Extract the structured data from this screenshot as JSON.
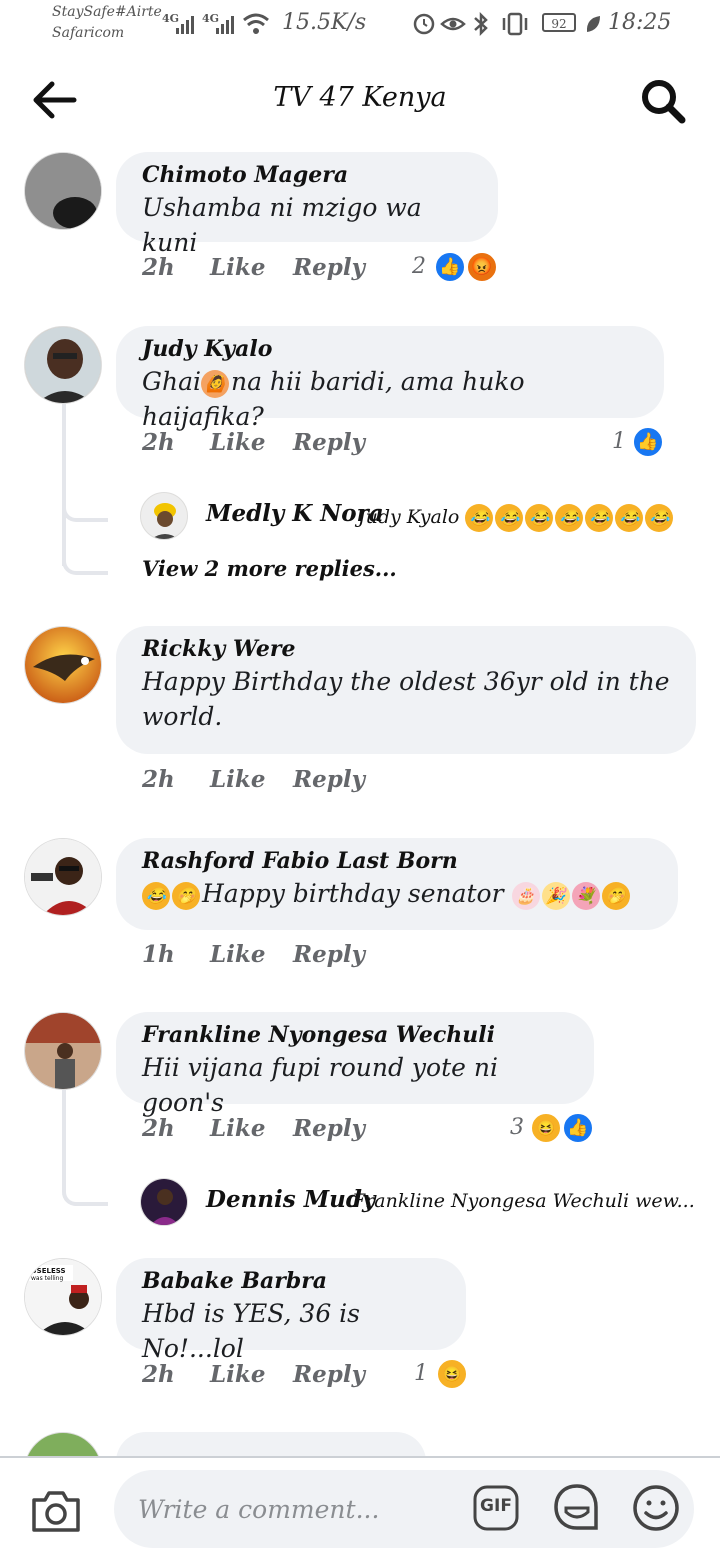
{
  "status_bar": {
    "carrier_1": "StaySafe#Airte",
    "carrier_2": "Safaricom",
    "network_1": "4G",
    "network_2": "4G",
    "speed": "15.5K/s",
    "battery": "92",
    "time": "18:25"
  },
  "header": {
    "title": "TV 47 Kenya"
  },
  "comments": [
    {
      "author": "Chimoto Magera",
      "text": "Ushamba ni mzigo wa kuni",
      "time": "2h",
      "like": "Like",
      "reply": "Reply",
      "reaction_count": "2",
      "reactions": [
        "like",
        "angry"
      ]
    },
    {
      "author": "Judy Kyalo",
      "text_a": "Ghai",
      "text_b": "na hii baridi, ama huko haijafika?",
      "time": "2h",
      "like": "Like",
      "reply": "Reply",
      "reaction_count": "1",
      "reactions": [
        "like"
      ],
      "reply_preview": {
        "author": "Medly K Nora",
        "text": "Judy Kyalo"
      },
      "view_more": "View 2 more replies..."
    },
    {
      "author": "Rickky Were",
      "text_line1": "Happy Birthday the oldest 36yr old in the",
      "text_line2": "world.",
      "time": "2h",
      "like": "Like",
      "reply": "Reply"
    },
    {
      "author": "Rashford Fabio Last Born",
      "text": "Happy birthday senator",
      "time": "1h",
      "like": "Like",
      "reply": "Reply"
    },
    {
      "author": "Frankline Nyongesa Wechuli",
      "text": "Hii vijana fupi round yote ni goon's",
      "time": "2h",
      "like": "Like",
      "reply": "Reply",
      "reaction_count": "3",
      "reactions": [
        "haha",
        "like"
      ],
      "reply_preview": {
        "author": "Dennis Mudy",
        "text": "Frankline Nyongesa Wechuli wew..."
      }
    },
    {
      "author": "Babake Barbra",
      "text": "Hbd is YES, 36 is No!...lol",
      "time": "2h",
      "like": "Like",
      "reply": "Reply",
      "reaction_count": "1",
      "reactions": [
        "haha"
      ]
    }
  ],
  "composer": {
    "placeholder": "Write a comment...",
    "gif_label": "GIF"
  },
  "colors": {
    "bubble": "#f0f2f5",
    "like_blue": "#1877f2",
    "meta_grey": "#65676b"
  }
}
